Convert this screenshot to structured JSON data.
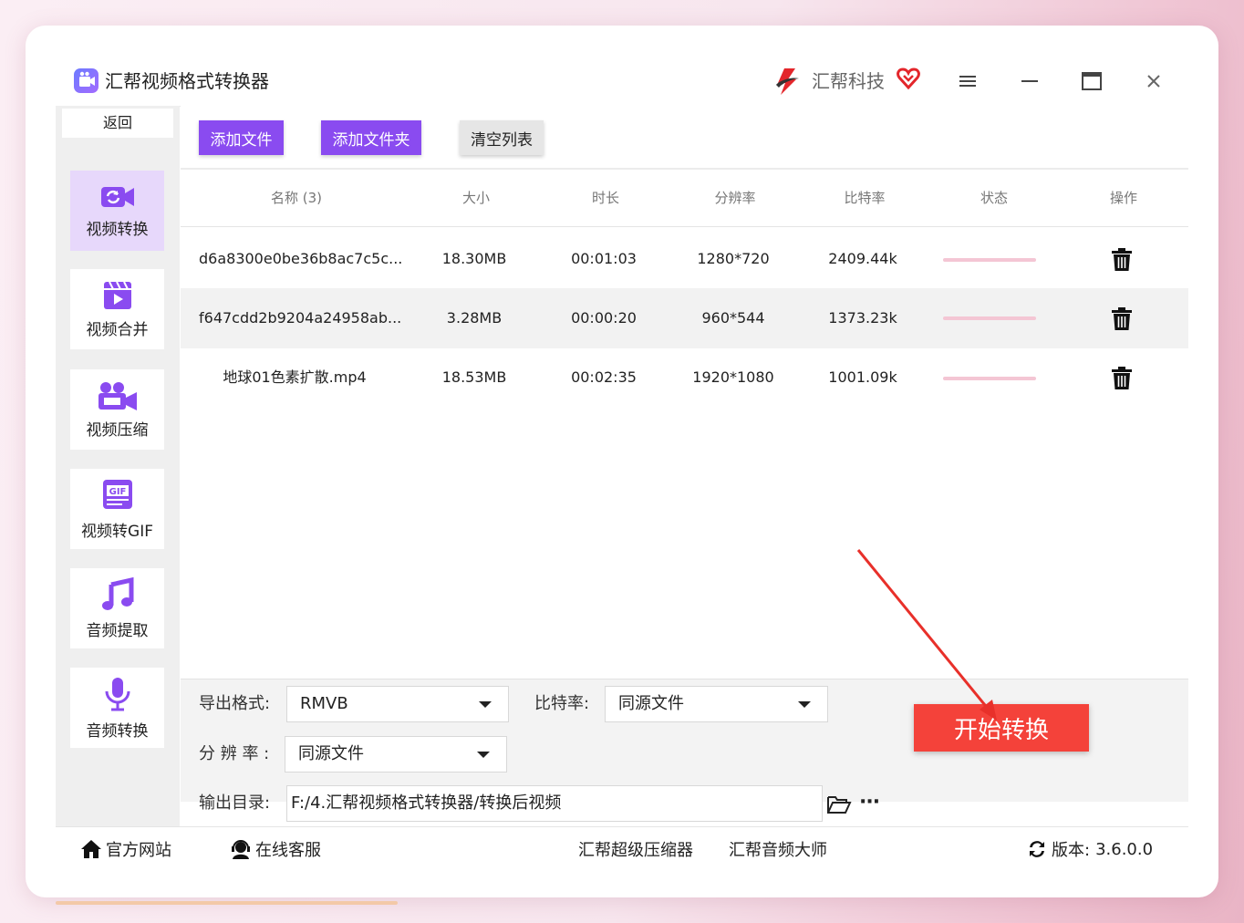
{
  "app": {
    "title": "汇帮视频格式转换器",
    "brand": "汇帮科技"
  },
  "sidebar": {
    "back": "返回",
    "items": [
      {
        "label": "视频转换",
        "icon": "video-convert-icon",
        "active": true
      },
      {
        "label": "视频合并",
        "icon": "video-merge-icon",
        "active": false
      },
      {
        "label": "视频压缩",
        "icon": "video-compress-icon",
        "active": false
      },
      {
        "label": "视频转GIF",
        "icon": "gif-icon",
        "active": false
      },
      {
        "label": "音频提取",
        "icon": "music-note-icon",
        "active": false
      },
      {
        "label": "音频转换",
        "icon": "microphone-icon",
        "active": false
      }
    ]
  },
  "toolbar": {
    "add_file": "添加文件",
    "add_folder": "添加文件夹",
    "clear_list": "清空列表"
  },
  "table": {
    "headers": [
      "名称 (3)",
      "大小",
      "时长",
      "分辨率",
      "比特率",
      "状态",
      "操作"
    ],
    "rows": [
      {
        "name": "d6a8300e0be36b8ac7c5c...",
        "size": "18.30MB",
        "duration": "00:01:03",
        "resolution": "1280*720",
        "bitrate": "2409.44k",
        "progress": 0
      },
      {
        "name": "f647cdd2b9204a24958ab...",
        "size": "3.28MB",
        "duration": "00:00:20",
        "resolution": "960*544",
        "bitrate": "1373.23k",
        "progress": 0
      },
      {
        "name": "地球01色素扩散.mp4",
        "size": "18.53MB",
        "duration": "00:02:35",
        "resolution": "1920*1080",
        "bitrate": "1001.09k",
        "progress": 0
      }
    ]
  },
  "settings": {
    "format_label": "导出格式:",
    "format_value": "RMVB",
    "bitrate_label": "比特率:",
    "bitrate_value": "同源文件",
    "resolution_label": "分 辨 率 :",
    "resolution_value": "同源文件",
    "output_label": "输出目录:",
    "output_path": "F:/4.汇帮视频格式转换器/转换后视频",
    "more": "···",
    "start": "开始转换"
  },
  "footer": {
    "website": "官方网站",
    "support": "在线客服",
    "link1": "汇帮超级压缩器",
    "link2": "汇帮音频大师",
    "version_label": "版本:",
    "version": "3.6.0.0"
  },
  "colors": {
    "accent": "#8a4bf0",
    "start": "#f4423a",
    "progress": "#f4c6d4"
  }
}
